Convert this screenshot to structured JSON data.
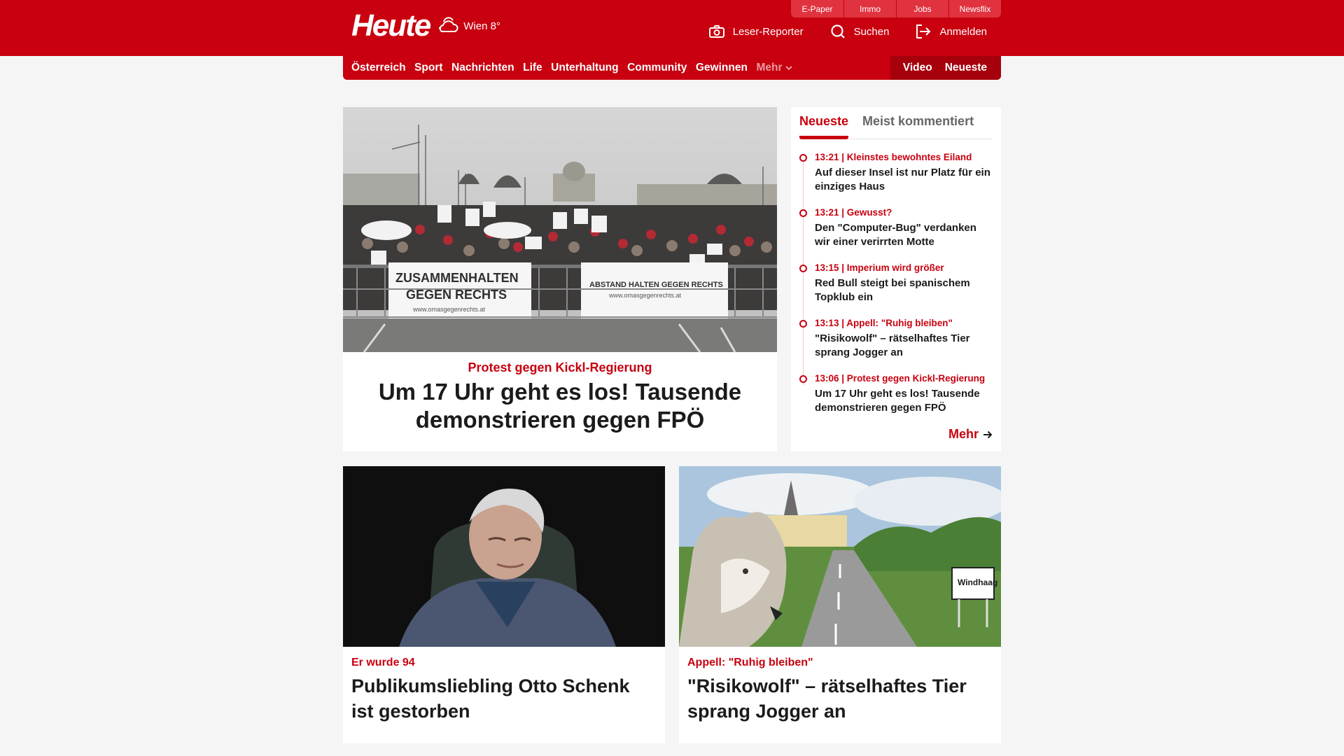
{
  "header": {
    "logo": "Heute",
    "weather": "Wien 8°",
    "util_tabs": [
      "E-Paper",
      "Immo",
      "Jobs",
      "Newsflix"
    ],
    "reporter_label": "Leser-Reporter",
    "search_label": "Suchen",
    "login_label": "Anmelden"
  },
  "nav": {
    "items": [
      "Österreich",
      "Sport",
      "Nachrichten",
      "Life",
      "Unterhaltung",
      "Community",
      "Gewinnen"
    ],
    "more_label": "Mehr",
    "video_label": "Video",
    "latest_label": "Neueste"
  },
  "hero": {
    "image_alt": "Demonstration in Wien",
    "banner_left_1": "ZUSAMMENHALTEN",
    "banner_left_2": "GEGEN RECHTS",
    "banner_left_url": "www.omasgegenrechts.at",
    "banner_right_1": "ABSTAND HALTEN GEGEN RECHTS",
    "banner_right_url": "www.omasgegenrechts.at",
    "kicker": "Protest gegen Kickl-Regierung",
    "title": "Um 17 Uhr geht es los! Tausende demonstrieren gegen FPÖ"
  },
  "ticker": {
    "tabs": [
      "Neueste",
      "Meist kommentiert"
    ],
    "items": [
      {
        "meta": "13:21 | Kleinstes bewohntes Eiland",
        "title": "Auf dieser Insel ist nur Platz für ein einziges Haus"
      },
      {
        "meta": "13:21 | Gewusst?",
        "title": "Den \"Computer-Bug\" verdanken wir einer verirrten Motte"
      },
      {
        "meta": "13:15 | Imperium wird größer",
        "title": "Red Bull steigt bei spanischem Topklub ein"
      },
      {
        "meta": "13:13 | Appell: \"Ruhig bleiben\"",
        "title": "\"Risikowolf\" – rätselhaftes Tier sprang Jogger an"
      },
      {
        "meta": "13:06 | Protest gegen Kickl-Regierung",
        "title": "Um 17 Uhr geht es los! Tausende demonstrieren gegen FPÖ"
      }
    ],
    "more_label": "Mehr"
  },
  "cards": [
    {
      "kicker": "Er wurde 94",
      "title": "Publikumsliebling Otto Schenk ist gestorben"
    },
    {
      "kicker": "Appell: \"Ruhig bleiben\"",
      "title": "\"Risikowolf\" – rätselhaftes Tier sprang Jogger an",
      "sign": "Windhaag"
    }
  ],
  "colors": {
    "brand": "#c8000f",
    "brand_dark": "#a5000c"
  }
}
